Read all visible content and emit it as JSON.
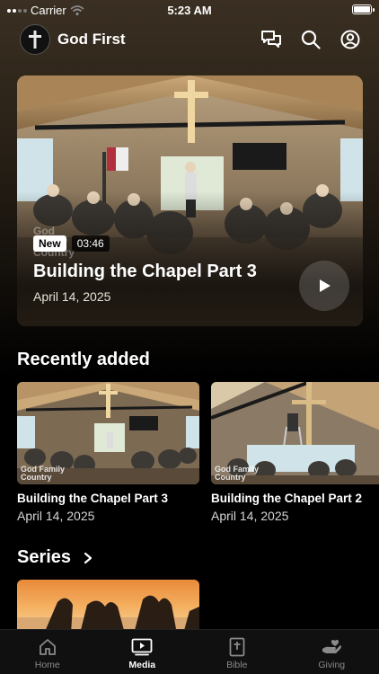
{
  "status_bar": {
    "carrier": "Carrier",
    "time": "5:23 AM"
  },
  "header": {
    "title": "God First"
  },
  "hero": {
    "badge_new": "New",
    "duration": "03:46",
    "title": "Building the Chapel Part 3",
    "date": "April 14, 2025",
    "watermark": "God Family Country"
  },
  "recently_added": {
    "title": "Recently added",
    "items": [
      {
        "title": "Building the Chapel Part 3",
        "date": "April 14, 2025",
        "watermark": "God Family Country"
      },
      {
        "title": "Building the Chapel Part 2",
        "date": "April 14, 2025",
        "watermark": "God Family Country"
      }
    ]
  },
  "series": {
    "title": "Series"
  },
  "tabbar": {
    "items": [
      {
        "label": "Home",
        "icon": "home-icon",
        "active": false
      },
      {
        "label": "Media",
        "icon": "media-icon",
        "active": true
      },
      {
        "label": "Bible",
        "icon": "bible-icon",
        "active": false
      },
      {
        "label": "Giving",
        "icon": "giving-icon",
        "active": false
      }
    ]
  }
}
